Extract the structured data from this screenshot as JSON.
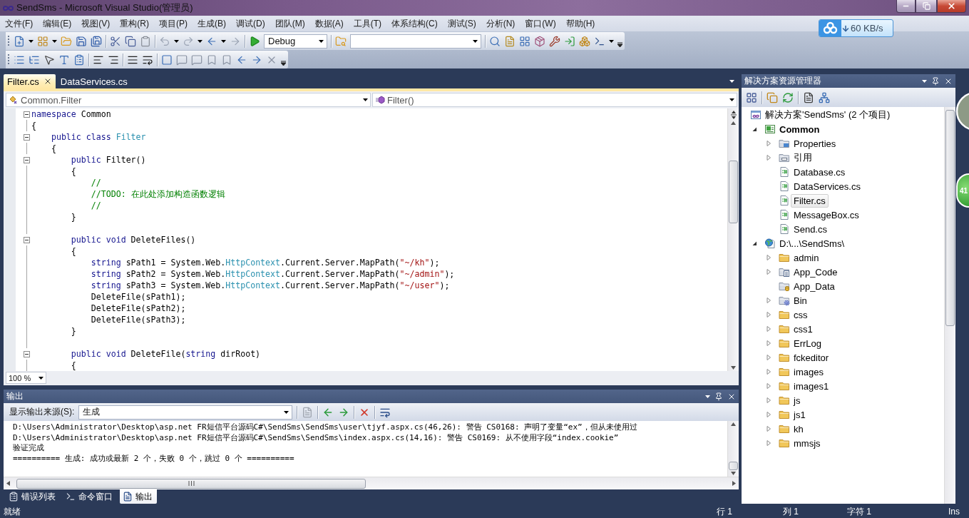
{
  "window": {
    "title": "SendSms - Microsoft Visual Studio(管理员)"
  },
  "menu": [
    "文件(F)",
    "编辑(E)",
    "视图(V)",
    "重构(R)",
    "项目(P)",
    "生成(B)",
    "调试(D)",
    "团队(M)",
    "数据(A)",
    "工具(T)",
    "体系结构(C)",
    "测试(S)",
    "分析(N)",
    "窗口(W)",
    "帮助(H)"
  ],
  "toolbar": {
    "configuration": "Debug"
  },
  "download_widget": {
    "speed": "60 KB/s"
  },
  "document_tabs": [
    {
      "label": "Filter.cs",
      "selected": true
    },
    {
      "label": "DataServices.cs",
      "selected": false
    }
  ],
  "editor": {
    "type_dropdown": "Common.Filter",
    "member_dropdown": "Filter()",
    "lines": [
      {
        "kind": "region",
        "expanded": true,
        "tokens": [
          {
            "kind": "keyword",
            "text": "namespace"
          },
          {
            "kind": "plain",
            "text": " Common"
          }
        ]
      },
      {
        "kind": "line",
        "tokens": [
          {
            "kind": "plain",
            "text": "{"
          }
        ]
      },
      {
        "kind": "region",
        "expanded": true,
        "tokens": [
          {
            "kind": "keyword",
            "text": "    public class"
          },
          {
            "kind": "type",
            "text": " Filter"
          }
        ]
      },
      {
        "kind": "line",
        "tokens": [
          {
            "kind": "plain",
            "text": "    {"
          }
        ]
      },
      {
        "kind": "region",
        "expanded": true,
        "tokens": [
          {
            "kind": "keyword",
            "text": "        public"
          },
          {
            "kind": "plain",
            "text": " Filter()"
          }
        ]
      },
      {
        "kind": "line",
        "tokens": [
          {
            "kind": "plain",
            "text": "        {"
          }
        ]
      },
      {
        "kind": "line",
        "tokens": [
          {
            "kind": "comment",
            "text": "            //"
          }
        ]
      },
      {
        "kind": "line",
        "tokens": [
          {
            "kind": "comment",
            "text": "            //TODO: 在此处添加构造函数逻辑"
          }
        ]
      },
      {
        "kind": "line",
        "tokens": [
          {
            "kind": "comment",
            "text": "            //"
          }
        ]
      },
      {
        "kind": "line",
        "tokens": [
          {
            "kind": "plain",
            "text": "        }"
          }
        ]
      },
      {
        "kind": "line"
      },
      {
        "kind": "region",
        "expanded": true,
        "tokens": [
          {
            "kind": "keyword",
            "text": "        public void"
          },
          {
            "kind": "plain",
            "text": " DeleteFiles()"
          }
        ]
      },
      {
        "kind": "line",
        "tokens": [
          {
            "kind": "plain",
            "text": "        {"
          }
        ]
      },
      {
        "kind": "line",
        "tokens": [
          {
            "kind": "keyword",
            "text": "            string"
          },
          {
            "kind": "plain",
            "text": " sPath1 = System.Web."
          },
          {
            "kind": "type",
            "text": "HttpContext"
          },
          {
            "kind": "plain",
            "text": ".Current.Server.MapPath("
          },
          {
            "kind": "string",
            "text": "\"~/kh\""
          },
          {
            "kind": "plain",
            "text": ");"
          }
        ]
      },
      {
        "kind": "line",
        "tokens": [
          {
            "kind": "keyword",
            "text": "            string"
          },
          {
            "kind": "plain",
            "text": " sPath2 = System.Web."
          },
          {
            "kind": "type",
            "text": "HttpContext"
          },
          {
            "kind": "plain",
            "text": ".Current.Server.MapPath("
          },
          {
            "kind": "string",
            "text": "\"~/admin\""
          },
          {
            "kind": "plain",
            "text": ");"
          }
        ]
      },
      {
        "kind": "line",
        "tokens": [
          {
            "kind": "keyword",
            "text": "            string"
          },
          {
            "kind": "plain",
            "text": " sPath3 = System.Web."
          },
          {
            "kind": "type",
            "text": "HttpContext"
          },
          {
            "kind": "plain",
            "text": ".Current.Server.MapPath("
          },
          {
            "kind": "string",
            "text": "\"~/user\""
          },
          {
            "kind": "plain",
            "text": ");"
          }
        ]
      },
      {
        "kind": "line",
        "tokens": [
          {
            "kind": "plain",
            "text": "            DeleteFile(sPath1);"
          }
        ]
      },
      {
        "kind": "line",
        "tokens": [
          {
            "kind": "plain",
            "text": "            DeleteFile(sPath2);"
          }
        ]
      },
      {
        "kind": "line",
        "tokens": [
          {
            "kind": "plain",
            "text": "            DeleteFile(sPath3);"
          }
        ]
      },
      {
        "kind": "line",
        "tokens": [
          {
            "kind": "plain",
            "text": "        }"
          }
        ]
      },
      {
        "kind": "line"
      },
      {
        "kind": "region",
        "expanded": true,
        "tokens": [
          {
            "kind": "keyword",
            "text": "        public void"
          },
          {
            "kind": "plain",
            "text": " DeleteFile("
          },
          {
            "kind": "keyword",
            "text": "string"
          },
          {
            "kind": "plain",
            "text": " dirRoot)"
          }
        ]
      },
      {
        "kind": "line",
        "tokens": [
          {
            "kind": "plain",
            "text": "        {"
          }
        ]
      }
    ],
    "zoom": "100 %"
  },
  "solution_explorer": {
    "title": "解决方案资源管理器",
    "tree": [
      {
        "label": "解决方案'SendSms' (2 个项目)",
        "kind": "solution",
        "selected": false,
        "children": [
          {
            "label": "Common",
            "kind": "project",
            "startup": true,
            "expanded": true,
            "selected": false,
            "children": [
              {
                "label": "Properties",
                "kind": "properties",
                "expanded": false,
                "selected": false
              },
              {
                "label": "引用",
                "kind": "references",
                "expanded": false,
                "selected": false
              },
              {
                "label": "Database.cs",
                "kind": "code_file",
                "selected": false
              },
              {
                "label": "DataServices.cs",
                "kind": "code_file",
                "selected": false
              },
              {
                "label": "Filter.cs",
                "kind": "code_file",
                "selected": true
              },
              {
                "label": "MessageBox.cs",
                "kind": "code_file",
                "selected": false
              },
              {
                "label": "Send.cs",
                "kind": "code_file",
                "selected": false
              }
            ]
          },
          {
            "label": "D:\\...\\SendSms\\",
            "kind": "website",
            "startup": false,
            "expanded": true,
            "selected": false,
            "children": [
              {
                "label": "admin",
                "kind": "folder",
                "expanded": false,
                "selected": false
              },
              {
                "label": "App_Code",
                "kind": "code_folder",
                "expanded": false,
                "selected": false
              },
              {
                "label": "App_Data",
                "kind": "data_folder",
                "selected": false
              },
              {
                "label": "Bin",
                "kind": "bin_folder",
                "expanded": false,
                "selected": false
              },
              {
                "label": "css",
                "kind": "folder",
                "expanded": false,
                "selected": false
              },
              {
                "label": "css1",
                "kind": "folder",
                "expanded": false,
                "selected": false
              },
              {
                "label": "ErrLog",
                "kind": "folder",
                "expanded": false,
                "selected": false
              },
              {
                "label": "fckeditor",
                "kind": "folder",
                "expanded": false,
                "selected": false
              },
              {
                "label": "images",
                "kind": "folder",
                "expanded": false,
                "selected": false
              },
              {
                "label": "images1",
                "kind": "folder",
                "expanded": false,
                "selected": false
              },
              {
                "label": "js",
                "kind": "folder",
                "expanded": false,
                "selected": false
              },
              {
                "label": "js1",
                "kind": "folder",
                "expanded": false,
                "selected": false
              },
              {
                "label": "kh",
                "kind": "folder",
                "expanded": false,
                "selected": false
              },
              {
                "label": "mmsjs",
                "kind": "folder",
                "expanded": false,
                "selected": false
              }
            ]
          }
        ]
      }
    ]
  },
  "floating_badge": {
    "count": "41"
  },
  "output": {
    "title": "输出",
    "source_label": "显示输出来源(S):",
    "source": "生成",
    "lines": [
      "D:\\Users\\Administrator\\Desktop\\asp.net FR短信平台源码C#\\SendSms\\SendSms\\user\\tjyf.aspx.cs(46,26): 警告 CS0168: 声明了变量“ex”，但从未使用过",
      "D:\\Users\\Administrator\\Desktop\\asp.net FR短信平台源码C#\\SendSms\\SendSms\\index.aspx.cs(14,16): 警告 CS0169: 从不使用字段“index.cookie”",
      "验证完成",
      "========== 生成: 成功或最新 2 个，失败 0 个，跳过 0 个 =========="
    ]
  },
  "bottom_tabs": [
    {
      "label": "错误列表",
      "kind": "errors",
      "selected": false
    },
    {
      "label": "命令窗口",
      "kind": "command",
      "selected": false
    },
    {
      "label": "输出",
      "kind": "output",
      "selected": true
    }
  ],
  "status_bar": {
    "message": "就绪",
    "line": "行 1",
    "column": "列 1",
    "character": "字符 1",
    "mode": "Ins"
  }
}
